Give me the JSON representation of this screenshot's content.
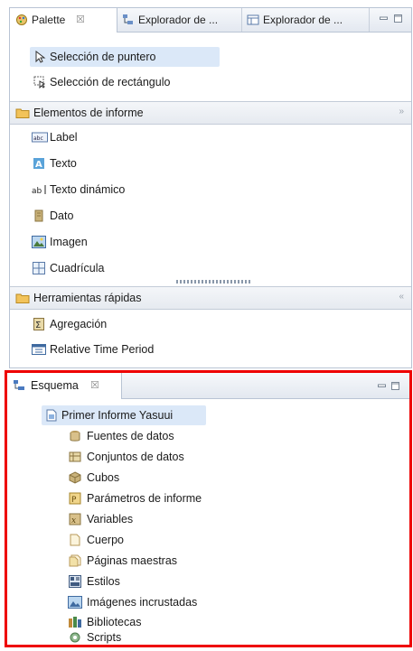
{
  "palette_view": {
    "tabs": [
      {
        "label": "Palette",
        "close": "☒"
      },
      {
        "label": "Explorador de ..."
      },
      {
        "label": "Explorador de ..."
      }
    ],
    "tools": [
      {
        "label": "Selección de puntero",
        "icon": "pointer-icon",
        "selected": true
      },
      {
        "label": "Selección de rectángulo",
        "icon": "rectangle-select-icon"
      }
    ],
    "sections": [
      {
        "title": "Elementos de informe",
        "icon": "folder-icon",
        "items": [
          {
            "label": "Label",
            "icon": "label-icon"
          },
          {
            "label": "Texto",
            "icon": "text-icon"
          },
          {
            "label": "Texto dinámico",
            "icon": "dynamic-text-icon"
          },
          {
            "label": "Dato",
            "icon": "data-icon"
          },
          {
            "label": "Imagen",
            "icon": "image-icon"
          },
          {
            "label": "Cuadrícula",
            "icon": "grid-icon"
          }
        ]
      },
      {
        "title": "Herramientas rápidas",
        "icon": "folder-icon",
        "items": [
          {
            "label": "Agregación",
            "icon": "aggregation-icon"
          },
          {
            "label": "Relative Time Period",
            "icon": "time-period-icon"
          }
        ]
      }
    ]
  },
  "outline_view": {
    "tab": {
      "label": "Esquema",
      "close": "☒"
    },
    "root": {
      "label": "Primer Informe Yasuui",
      "icon": "report-icon"
    },
    "children": [
      {
        "label": "Fuentes de datos",
        "icon": "data-sources-icon"
      },
      {
        "label": "Conjuntos de datos",
        "icon": "data-sets-icon"
      },
      {
        "label": "Cubos",
        "icon": "cubes-icon"
      },
      {
        "label": "Parámetros de informe",
        "icon": "parameters-icon"
      },
      {
        "label": "Variables",
        "icon": "variables-icon"
      },
      {
        "label": "Cuerpo",
        "icon": "body-icon"
      },
      {
        "label": "Páginas maestras",
        "icon": "master-pages-icon"
      },
      {
        "label": "Estilos",
        "icon": "styles-icon"
      },
      {
        "label": "Imágenes incrustadas",
        "icon": "embedded-images-icon"
      },
      {
        "label": "Bibliotecas",
        "icon": "libraries-icon"
      },
      {
        "label": "Scripts",
        "icon": "scripts-icon"
      }
    ]
  },
  "colors": {
    "highlight_frame": "#ee0000",
    "selection": "#dbe8f8"
  }
}
